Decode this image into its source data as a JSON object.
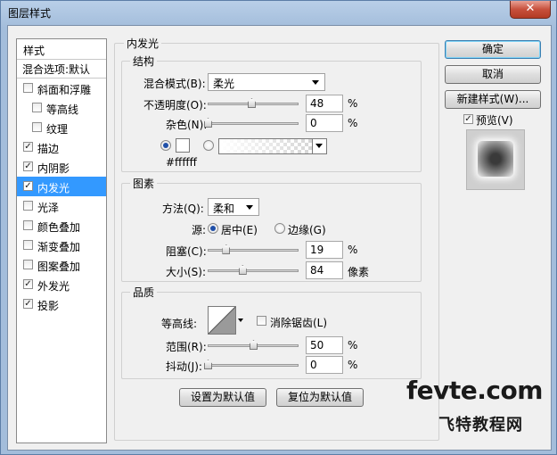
{
  "window": {
    "title": "图层样式",
    "close_glyph": "✕"
  },
  "style_list": {
    "header": "样式",
    "blend_options": "混合选项:默认",
    "items": [
      {
        "label": "斜面和浮雕",
        "checked": false,
        "indent": false
      },
      {
        "label": "等高线",
        "checked": false,
        "indent": true
      },
      {
        "label": "纹理",
        "checked": false,
        "indent": true
      },
      {
        "label": "描边",
        "checked": true,
        "indent": false
      },
      {
        "label": "内阴影",
        "checked": true,
        "indent": false
      },
      {
        "label": "内发光",
        "checked": true,
        "indent": false,
        "selected": true
      },
      {
        "label": "光泽",
        "checked": false,
        "indent": false
      },
      {
        "label": "颜色叠加",
        "checked": false,
        "indent": false
      },
      {
        "label": "渐变叠加",
        "checked": false,
        "indent": false
      },
      {
        "label": "图案叠加",
        "checked": false,
        "indent": false
      },
      {
        "label": "外发光",
        "checked": true,
        "indent": false
      },
      {
        "label": "投影",
        "checked": true,
        "indent": false
      }
    ]
  },
  "panel": {
    "title": "内发光",
    "structure": {
      "title": "结构",
      "blend_mode_label": "混合模式(B):",
      "blend_mode_value": "柔光",
      "opacity_label": "不透明度(O):",
      "opacity_value": "48",
      "opacity_unit": "%",
      "noise_label": "杂色(N):",
      "noise_value": "0",
      "noise_unit": "%",
      "color_hex": "#ffffff"
    },
    "elements": {
      "title": "图素",
      "method_label": "方法(Q):",
      "method_value": "柔和",
      "source_label": "源:",
      "source_center": "居中(E)",
      "source_edge": "边缘(G)",
      "choke_label": "阻塞(C):",
      "choke_value": "19",
      "choke_unit": "%",
      "size_label": "大小(S):",
      "size_value": "84",
      "size_unit": "像素"
    },
    "quality": {
      "title": "品质",
      "contour_label": "等高线:",
      "antialias_label": "消除锯齿(L)",
      "antialias_checked": false,
      "range_label": "范围(R):",
      "range_value": "50",
      "range_unit": "%",
      "jitter_label": "抖动(J):",
      "jitter_value": "0",
      "jitter_unit": "%"
    },
    "make_default": "设置为默认值",
    "reset_default": "复位为默认值"
  },
  "buttons": {
    "ok": "确定",
    "cancel": "取消",
    "new_style": "新建样式(W)...",
    "preview_label": "预览(V)",
    "preview_checked": true
  },
  "watermark": {
    "line1": "fevte.com",
    "line2": "飞特教程网"
  }
}
